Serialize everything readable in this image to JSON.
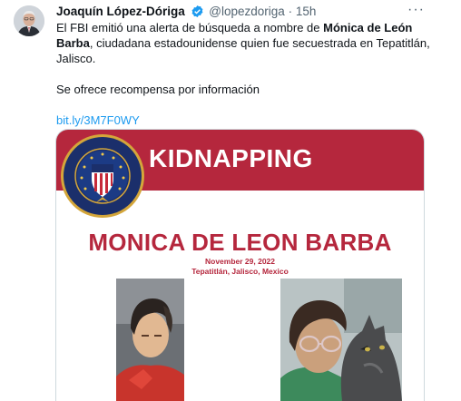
{
  "tweet": {
    "author_name": "Joaquín López-Dóriga",
    "handle": "@lopezdoriga",
    "separator": "·",
    "time": "15h",
    "more_label": "···",
    "text_part1": "El FBI emitió una alerta de búsqueda a nombre de ",
    "text_bold": "Mónica de León Barba",
    "text_part2": ", ciudadana estadounidense quien fue secuestrada en Tepatitlán, Jalisco.",
    "text_line2": "Se ofrece recompensa por información",
    "link": "bit.ly/3M7F0WY"
  },
  "poster": {
    "banner_title": "KIDNAPPING",
    "person_name": "MONICA DE LEON BARBA",
    "date": "November 29, 2022",
    "location": "Tepatitlán, Jalisco, Mexico",
    "banner_color": "#b5273d"
  },
  "colors": {
    "link": "#1d9bf0",
    "verified": "#1d9bf0",
    "muted": "#536471"
  },
  "icons": {
    "verified": "verified-badge-icon",
    "more": "more-icon",
    "seal": "fbi-seal-icon"
  }
}
